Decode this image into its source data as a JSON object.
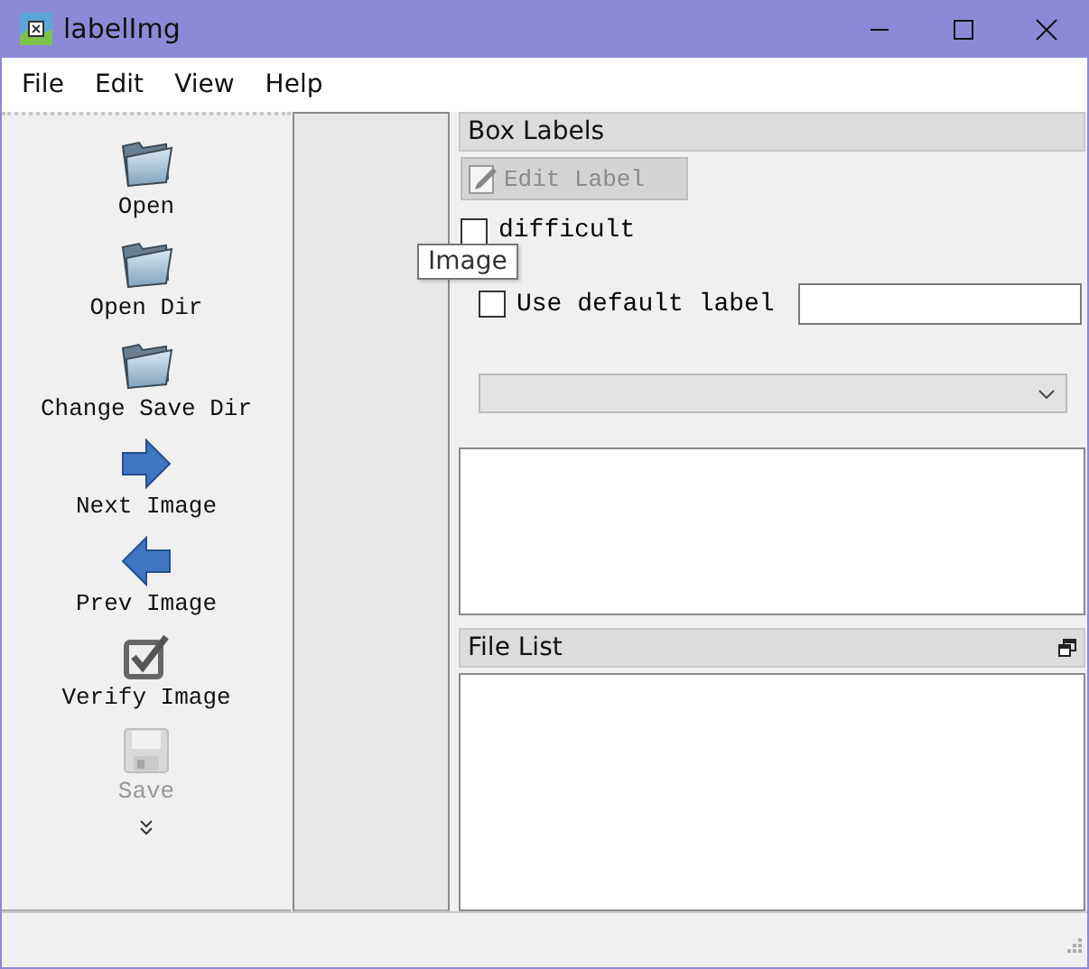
{
  "window": {
    "title": "labelImg"
  },
  "menu": [
    "File",
    "Edit",
    "View",
    "Help"
  ],
  "toolbar": [
    {
      "label": "Open",
      "kind": "folder",
      "disabled": false
    },
    {
      "label": "Open Dir",
      "kind": "folder",
      "disabled": false
    },
    {
      "label": "Change Save Dir",
      "kind": "folder",
      "disabled": false
    },
    {
      "label": "Next Image",
      "kind": "next",
      "disabled": false
    },
    {
      "label": "Prev Image",
      "kind": "prev",
      "disabled": false
    },
    {
      "label": "Verify Image",
      "kind": "verify",
      "disabled": false
    },
    {
      "label": "Save",
      "kind": "save",
      "disabled": true
    }
  ],
  "box_labels": {
    "title": "Box Labels",
    "edit_button": {
      "label": "Edit Label",
      "disabled": true
    },
    "difficult": {
      "label": "difficult",
      "checked": false
    },
    "use_default_label": {
      "label": "Use default label",
      "checked": false
    }
  },
  "file_list": {
    "title": "File List"
  },
  "tooltip": {
    "text": "Image"
  }
}
